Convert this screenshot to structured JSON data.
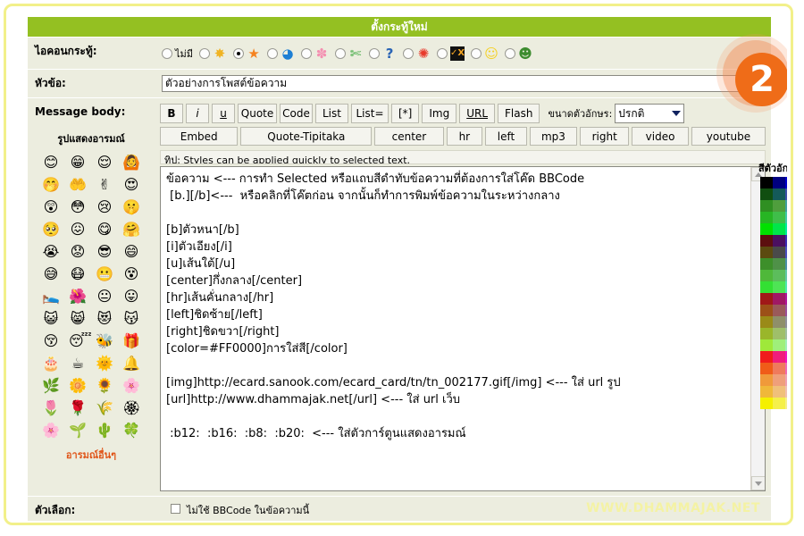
{
  "header": {
    "title": "ตั้งกระทู้ใหม่"
  },
  "badge": {
    "number": "2",
    "color": "#ef6c18"
  },
  "rows": {
    "icon_label": "ไอคอนกระทู้:",
    "subject_label": "หัวข้อ:",
    "body_label": "Message body:",
    "options_label": "ตัวเลือก:"
  },
  "topic_icons": {
    "none_label": "ไม่มี",
    "selected_index": 2,
    "items": [
      {
        "name": "no-icon",
        "glyph": ""
      },
      {
        "name": "wheel-icon",
        "glyph": "✸",
        "color": "#f0b323"
      },
      {
        "name": "star-icon",
        "glyph": "★",
        "color": "#f58220"
      },
      {
        "name": "color-wheel-icon",
        "glyph": "◕",
        "color": "#1d7fd4"
      },
      {
        "name": "pink-flower-icon",
        "glyph": "✽",
        "color": "#f48fb1"
      },
      {
        "name": "green-ribbon-icon",
        "glyph": "✄",
        "color": "#36a63a"
      },
      {
        "name": "question-icon",
        "glyph": "?",
        "color": "#2a64b5"
      },
      {
        "name": "red-sun-icon",
        "glyph": "✺",
        "color": "#e8392b"
      },
      {
        "name": "check-x-icon",
        "glyph": "✓X",
        "color": "#f5a623"
      },
      {
        "name": "yellow-smiley-icon",
        "glyph": "☺",
        "color": "#f5d020"
      },
      {
        "name": "green-grin-icon",
        "glyph": "☻",
        "color": "#3d8c2f"
      }
    ]
  },
  "subject": {
    "value": "ตัวอย่างการโพสต์ข้อความ",
    "placeholder": ""
  },
  "smileys": {
    "title": "รูปแสดงอารมณ์",
    "more_label": "อารมณ์อื่นๆ",
    "grid": [
      [
        "😊",
        "😁",
        "😌",
        "🙆"
      ],
      [
        "🤭",
        "🤲",
        "✌",
        "😍"
      ],
      [
        "😲",
        "😳",
        "😢",
        "🤫"
      ],
      [
        "🥺",
        "😖",
        "😋",
        "🤗"
      ],
      [
        "😭",
        "😟",
        "😎",
        "😄"
      ],
      [
        "😅",
        "😷",
        "😬",
        "😵"
      ],
      [
        "🛌",
        "🌺",
        "😐",
        "😛"
      ],
      [
        "😺",
        "😸",
        "😻",
        "😽"
      ],
      [
        "😚",
        "😴",
        "🐝",
        "🎁"
      ],
      [
        "🎂",
        "☕",
        "🌞",
        "🔔"
      ],
      [
        "🌿",
        "🌼",
        "🌻",
        "🌸"
      ],
      [
        "🌷",
        "🌹",
        "🌾",
        "🏵"
      ],
      [
        "🌸",
        "🌱",
        "🌵",
        "🍀"
      ]
    ]
  },
  "toolbar": {
    "row1": [
      {
        "label": "B",
        "name": "bold-button",
        "style": "bold"
      },
      {
        "label": "i",
        "name": "italic-button",
        "style": "ital"
      },
      {
        "label": "u",
        "name": "underline-button",
        "style": "und"
      },
      {
        "label": "Quote",
        "name": "quote-button",
        "style": "w-quote"
      },
      {
        "label": "Code",
        "name": "code-button",
        "style": "w-code"
      },
      {
        "label": "List",
        "name": "list-button",
        "style": ""
      },
      {
        "label": "List=",
        "name": "ordered-list-button",
        "style": "w-listeq"
      },
      {
        "label": "[*]",
        "name": "list-item-button",
        "style": ""
      },
      {
        "label": "Img",
        "name": "image-button",
        "style": ""
      },
      {
        "label": "URL",
        "name": "url-button",
        "style": "und"
      },
      {
        "label": "Flash",
        "name": "flash-button",
        "style": ""
      }
    ],
    "row2": [
      {
        "label": "Embed",
        "name": "embed-button",
        "style": "b-embed"
      },
      {
        "label": "Quote-Tipitaka",
        "name": "quote-tipitaka-button",
        "style": "b-quotetip"
      },
      {
        "label": "center",
        "name": "center-button",
        "style": "b-center"
      },
      {
        "label": "hr",
        "name": "hr-button",
        "style": "b-hr"
      },
      {
        "label": "left",
        "name": "left-button",
        "style": "b-left"
      },
      {
        "label": "mp3",
        "name": "mp3-button",
        "style": "b-mp3"
      },
      {
        "label": "right",
        "name": "right-button",
        "style": "b-right"
      },
      {
        "label": "video",
        "name": "video-button",
        "style": "b-video"
      },
      {
        "label": "youtube",
        "name": "youtube-button",
        "style": "b-youtube"
      }
    ],
    "font_size_label": "ขนาดตัวอักษร:",
    "font_size_value": "ปรกติ",
    "font_size_options": [
      "ปรกติ"
    ],
    "tip": "ทิป: Styles can be applied quickly to selected text."
  },
  "message_body": {
    "value": "ข้อความ <--- การทำ Selected หรือแถบสีดำทับข้อความที่ต้องการใส่โค๊ด BBCode\n [b.][/b]<---  หรือคลิกที่โค๊ตก่อน จากนั้นก็ทำการพิมพ์ข้อความในระหว่างกลาง\n\n[b]ตัวหนา[/b]\n[i]ตัวเอียง[/i]\n[u]เส้นใต้[/u]\n[center]กึ่งกลาง[/center]\n[hr]เส้นคั่นกลาง[/hr]\n[left]ชิดซ้าย[/left]\n[right]ชิดขวา[/right]\n[color=#FF0000]การใส่สี[/color]\n\n[img]http://ecard.sanook.com/ecard_card/tn/tn_002177.gif[/img] <--- ใส่ url รูป\n[url]http://www.dhammajak.net[/url] <--- ใส่ url เว็บ\n\n :b12:  :b16:  :b8:  :b20:  <--- ใส่ตัวการ์ตูนแสดงอารมณ์"
  },
  "color_palette": {
    "label": "สีตัวอักษร",
    "rows": [
      [
        "#000000",
        "#000080",
        "#0000cd",
        "#0000ff"
      ],
      [
        "#104e10",
        "#145a5a",
        "#3a4fa8",
        "#1c5fc0"
      ],
      [
        "#2f8f22",
        "#4f9e3d",
        "#3f9e9e",
        "#2f86c8"
      ],
      [
        "#27b524",
        "#3fbe4a",
        "#3fc7a8",
        "#33b6c9"
      ],
      [
        "#00e000",
        "#00e54a",
        "#00e9a0",
        "#00e6e6"
      ],
      [
        "#5c0f0f",
        "#4b1060",
        "#3a2bb5",
        "#3c2fd6"
      ],
      [
        "#5c4a10",
        "#4a4a4a",
        "#4a4fc0",
        "#4450d8"
      ],
      [
        "#3d8f2a",
        "#4f9148",
        "#4b8fa8",
        "#4f7fd0"
      ],
      [
        "#4fb83a",
        "#5cbd5c",
        "#63c7a8",
        "#5fb6d8"
      ],
      [
        "#33e033",
        "#4ee455",
        "#4fe7b0",
        "#4fe2e2"
      ],
      [
        "#a01818",
        "#a01864",
        "#b0169c",
        "#8b1bd0"
      ],
      [
        "#9c5018",
        "#9a5a5a",
        "#9a4f9a",
        "#8a54c8"
      ],
      [
        "#9a8a18",
        "#8f8f6a",
        "#8f8f9a",
        "#8a90c8"
      ],
      [
        "#9ab62a",
        "#9fbf6a",
        "#9fbf9f",
        "#9fb6d8"
      ],
      [
        "#9fe83a",
        "#9fef7a",
        "#9fefb8",
        "#9fe8e8"
      ],
      [
        "#f01c1c",
        "#f01c7c",
        "#f016c0",
        "#d01cf0"
      ],
      [
        "#f05c18",
        "#ef7a5c",
        "#ef6ab0",
        "#d06ae0"
      ],
      [
        "#f09a3a",
        "#ef9f7a",
        "#efa0b0",
        "#d0a0e0"
      ],
      [
        "#f0b83a",
        "#f0c07a",
        "#f0c0b0",
        "#efb9c8"
      ],
      [
        "#f5f000",
        "#f5f04a",
        "#f5f08a",
        "#f5f0c0"
      ]
    ]
  },
  "options": {
    "checkbox_label": "ไม่ใช้ BBCode ในข้อความนี้",
    "checked": false
  },
  "watermark": {
    "text": "WWW.DHAMMAJAK.NET",
    "color": "#f4f2a4"
  }
}
